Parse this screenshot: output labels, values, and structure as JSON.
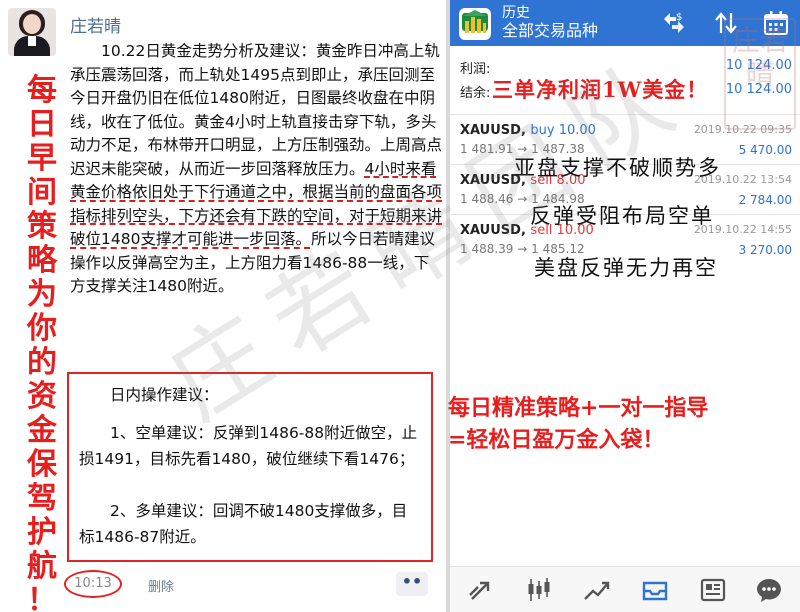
{
  "chat": {
    "username": "庄若晴",
    "post_plain_1": "10.22日黄金走势分析及建议：黄金昨日冲高上轨承压震荡回落，而上轨处1495点到即止，承压回测至今日开盘仍旧在低位1480附近，日图最终收盘在中阴线，收在了低位。黄金4小时上轨直接击穿下轨，多头动力不足，布林带开口明显，上方压制强劲。上周高点迟迟未能突破，从而近一步回落释放压力。",
    "post_underlined": "4小时来看黄金价格依旧处于下行通道之中，根据当前的盘面各项指标排列空头，下方还会有下跌的空间，对于短期来讲破位1480支撑才可能进一步回落。",
    "post_plain_2": "所以今日若晴建议操作以反弹高空为主，上方阻力看1486-88一线，下方支撑关注1480附近。",
    "box_title": "日内操作建议：",
    "box_item_1": "1、空单建议：反弹到1486-88附近做空，止损1491，目标先看1480，破位继续下看1476；",
    "box_item_2": "2、多单建议：回调不破1480支撑做多，目标1486-87附近。",
    "vertical_slogan": [
      "每",
      "日",
      "早",
      "间",
      "策",
      "略",
      "为",
      "你",
      "的",
      "资",
      "金",
      "保",
      "驾",
      "护",
      "航",
      "！"
    ],
    "time": "10:13",
    "delete_label": "删除",
    "more_label": "••"
  },
  "app": {
    "title": "历史",
    "subtitle": "全部交易品种",
    "summary": {
      "profit_label": "利润:",
      "profit_value": "10 124.00",
      "balance_label": "结余:",
      "balance_value": "10 124.00"
    },
    "headline": "三单净利润1W美金！",
    "trades": [
      {
        "symbol": "XAUUSD,",
        "side": "buy 10.00",
        "side_type": "buy",
        "open": "1 481.91",
        "close": "1 487.38",
        "date": "2019.10.22 09:35",
        "profit": "5 470.00"
      },
      {
        "symbol": "XAUUSD,",
        "side": "sell 8.00",
        "side_type": "sell",
        "open": "1 488.46",
        "close": "1 484.98",
        "date": "2019.10.22 13:54",
        "profit": "2 784.00"
      },
      {
        "symbol": "XAUUSD,",
        "side": "sell 10.00",
        "side_type": "sell",
        "open": "1 488.39",
        "close": "1 485.12",
        "date": "2019.10.22 14:55",
        "profit": "3 270.00"
      }
    ],
    "overlay_1": "亚盘支撑不破顺势多",
    "overlay_2": "反弹受阻布局空单",
    "overlay_3": "美盘反弹无力再空",
    "arrow": "→"
  },
  "promo": {
    "line1": "每日精准策略+一对一指导",
    "line2": "=轻松日盈万金入袋！"
  },
  "watermark": {
    "text": "庄若晴团队",
    "seal": "庄若晴"
  },
  "colors": {
    "brand_blue": "#2f74d2",
    "accent_red": "#e61e1e"
  },
  "icons": {
    "appbar": [
      "mt-logo-icon",
      "currency-switch-icon",
      "sort-icon",
      "calendar-icon"
    ],
    "tabbar": [
      "quotes-icon",
      "chart-icon",
      "trade-icon",
      "history-icon",
      "news-icon",
      "chat-icon"
    ]
  }
}
